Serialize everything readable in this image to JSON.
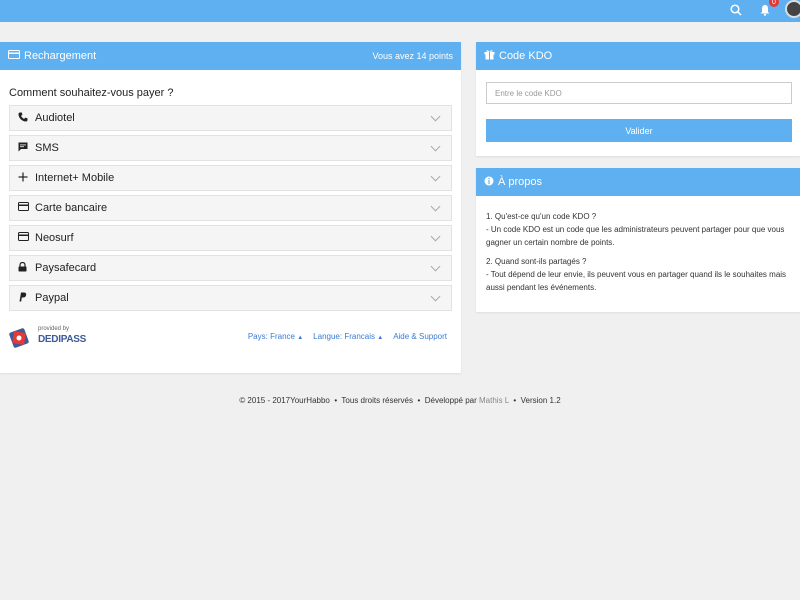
{
  "topbar": {
    "notification_count": "0",
    "icons": [
      "search-icon",
      "bell-icon",
      "avatar"
    ]
  },
  "recharge": {
    "title": "Rechargement",
    "points_text": "Vous avez 14 points",
    "question": "Comment souhaitez-vous payer ?",
    "methods": [
      {
        "label": "Audiotel",
        "icon": "phone-icon"
      },
      {
        "label": "SMS",
        "icon": "chat-icon"
      },
      {
        "label": "Internet+ Mobile",
        "icon": "plus-icon"
      },
      {
        "label": "Carte bancaire",
        "icon": "card-icon"
      },
      {
        "label": "Neosurf",
        "icon": "card-icon"
      },
      {
        "label": "Paysafecard",
        "icon": "lock-icon"
      },
      {
        "label": "Paypal",
        "icon": "paypal-icon"
      }
    ],
    "provider_small": "provided by",
    "provider_name": "DEDIPASS",
    "links": {
      "country": "Pays: France",
      "language": "Langue: Francais",
      "help": "Aide & Support"
    }
  },
  "kdo": {
    "title": "Code KDO",
    "placeholder": "Entre le code KDO",
    "button": "Valider"
  },
  "about": {
    "title": "À propos",
    "q1": "1. Qu'est-ce qu'un code KDO ?",
    "a1": "- Un code KDO est un code que les administrateurs peuvent partager pour que vous gagner un certain nombre de points.",
    "q2": "2. Quand sont-ils partagés ?",
    "a2": "- Tout dépend de leur envie, ils peuvent vous en partager quand ils le souhaites mais aussi pendant les événements."
  },
  "footer": {
    "copyright": "© 2015 - 2017YourHabbo",
    "rights": "Tous droits réservés",
    "dev_prefix": "Développé par",
    "author": "Mathis L",
    "version": "Version 1.2"
  },
  "colors": {
    "accent": "#5fb0f0",
    "link": "#3a7bd5",
    "background": "#f0f0f0"
  }
}
